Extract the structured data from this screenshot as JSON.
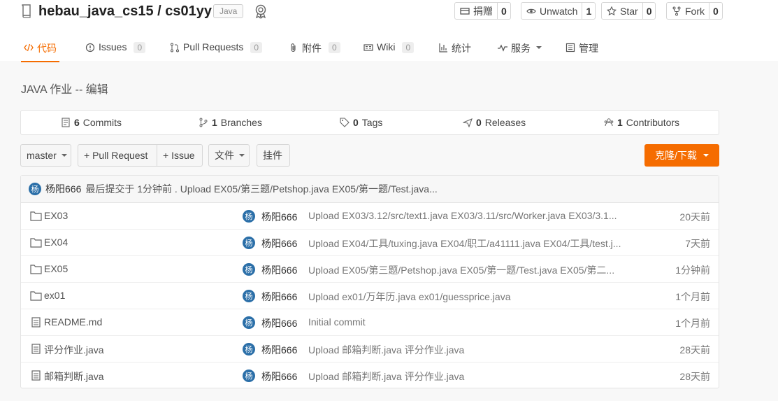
{
  "repo": {
    "owner": "hebau_java_cs15",
    "separator": " / ",
    "name": "cs01yy",
    "language": "Java"
  },
  "actions": {
    "donate": {
      "label": "捐赠",
      "count": "0"
    },
    "watch": {
      "label": "Unwatch",
      "count": "1"
    },
    "star": {
      "label": "Star",
      "count": "0"
    },
    "fork": {
      "label": "Fork",
      "count": "0"
    }
  },
  "tabs": [
    {
      "label": "代码",
      "icon": "code-icon",
      "active": true
    },
    {
      "label": "Issues",
      "count": "0",
      "icon": "issue-icon"
    },
    {
      "label": "Pull Requests",
      "count": "0",
      "icon": "pull-request-icon"
    },
    {
      "label": "附件",
      "count": "0",
      "icon": "attachment-icon"
    },
    {
      "label": "Wiki",
      "count": "0",
      "icon": "wiki-icon"
    },
    {
      "label": "统计",
      "icon": "stats-icon"
    },
    {
      "label": "服务",
      "icon": "pulse-icon",
      "dropdown": true
    },
    {
      "label": "管理",
      "icon": "settings-icon"
    }
  ],
  "description": "JAVA 作业 -- 编辑",
  "stats": {
    "commits": {
      "count": "6",
      "label": "Commits"
    },
    "branches": {
      "count": "1",
      "label": "Branches"
    },
    "tags": {
      "count": "0",
      "label": "Tags"
    },
    "releases": {
      "count": "0",
      "label": "Releases"
    },
    "contributors": {
      "count": "1",
      "label": "Contributors"
    }
  },
  "toolbar": {
    "branch": "master",
    "pull_request": "+ Pull Request",
    "issue": "+ Issue",
    "files": "文件",
    "widgets": "挂件",
    "clone": "克隆/下载"
  },
  "last_commit": {
    "avatar": "杨",
    "author": "杨阳666",
    "text": "最后提交于 1分钟前 . Upload EX05/第三题/Petshop.java EX05/第一题/Test.java..."
  },
  "files": [
    {
      "type": "folder",
      "name": "EX03",
      "avatar": "杨",
      "author": "杨阳666",
      "message": "Upload EX03/3.12/src/text1.java EX03/3.11/src/Worker.java EX03/3.1...",
      "time": "20天前"
    },
    {
      "type": "folder",
      "name": "EX04",
      "avatar": "杨",
      "author": "杨阳666",
      "message": "Upload EX04/工具/tuxing.java EX04/职工/a41111.java EX04/工具/test.j...",
      "time": "7天前"
    },
    {
      "type": "folder",
      "name": "EX05",
      "avatar": "杨",
      "author": "杨阳666",
      "message": "Upload EX05/第三题/Petshop.java EX05/第一题/Test.java EX05/第二...",
      "time": "1分钟前"
    },
    {
      "type": "folder",
      "name": "ex01",
      "avatar": "杨",
      "author": "杨阳666",
      "message": "Upload ex01/万年历.java ex01/guessprice.java",
      "time": "1个月前"
    },
    {
      "type": "file",
      "name": "README.md",
      "avatar": "杨",
      "author": "杨阳666",
      "message": "Initial commit",
      "time": "1个月前"
    },
    {
      "type": "file",
      "name": "评分作业.java",
      "avatar": "杨",
      "author": "杨阳666",
      "message": "Upload 邮箱判断.java 评分作业.java",
      "time": "28天前"
    },
    {
      "type": "file",
      "name": "邮箱判断.java",
      "avatar": "杨",
      "author": "杨阳666",
      "message": "Upload 邮箱判断.java 评分作业.java",
      "time": "28天前"
    }
  ],
  "colors": {
    "accent": "#f56c00",
    "avatar": "#2b6fa8"
  }
}
